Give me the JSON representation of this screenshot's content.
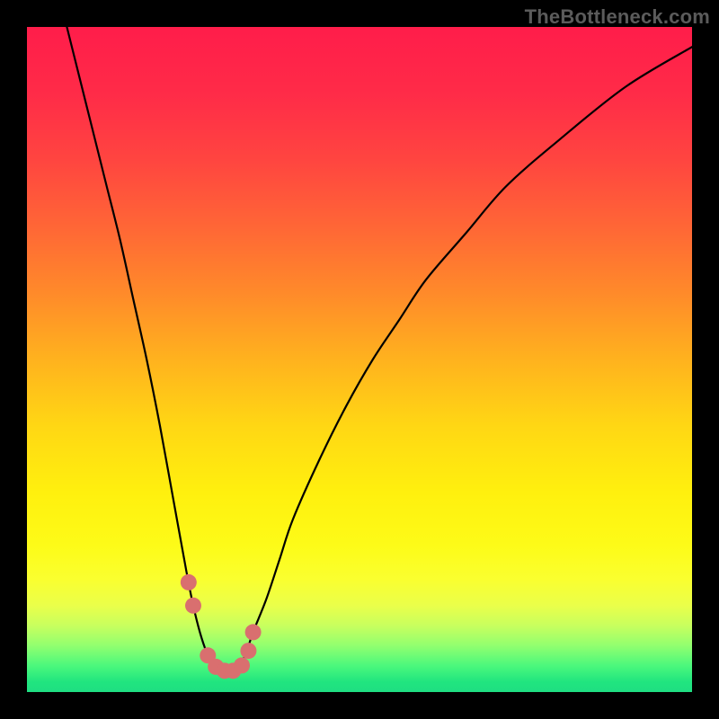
{
  "watermark": "TheBottleneck.com",
  "gradient_stops": [
    {
      "offset": 0.0,
      "color": "#ff1d4a"
    },
    {
      "offset": 0.1,
      "color": "#ff2b48"
    },
    {
      "offset": 0.2,
      "color": "#ff4540"
    },
    {
      "offset": 0.3,
      "color": "#ff6636"
    },
    {
      "offset": 0.4,
      "color": "#ff8a2a"
    },
    {
      "offset": 0.5,
      "color": "#ffb21e"
    },
    {
      "offset": 0.6,
      "color": "#ffd714"
    },
    {
      "offset": 0.7,
      "color": "#fff00e"
    },
    {
      "offset": 0.78,
      "color": "#fdfb18"
    },
    {
      "offset": 0.83,
      "color": "#faff2f"
    },
    {
      "offset": 0.87,
      "color": "#eaff4a"
    },
    {
      "offset": 0.9,
      "color": "#c8ff5e"
    },
    {
      "offset": 0.93,
      "color": "#92ff6f"
    },
    {
      "offset": 0.96,
      "color": "#4cf87c"
    },
    {
      "offset": 0.985,
      "color": "#20e57f"
    },
    {
      "offset": 1.0,
      "color": "#1fde82"
    }
  ],
  "marker_color": "#d96f6f",
  "marker_radius": 9,
  "curve_stroke": "#000000",
  "curve_width": 2.2,
  "chart_data": {
    "type": "line",
    "title": "",
    "xlabel": "",
    "ylabel": "",
    "xlim": [
      0,
      100
    ],
    "ylim": [
      0,
      100
    ],
    "series": [
      {
        "name": "bottleneck-curve",
        "x": [
          6,
          8,
          10,
          12,
          14,
          16,
          18,
          20,
          22,
          24,
          25,
          26,
          27,
          28,
          29,
          30,
          31,
          32,
          33,
          34,
          36,
          38,
          40,
          44,
          48,
          52,
          56,
          60,
          66,
          72,
          80,
          90,
          100
        ],
        "y": [
          100,
          92,
          84,
          76,
          68,
          59,
          50,
          40,
          29,
          18,
          13,
          9,
          6,
          4,
          3,
          3,
          3,
          4,
          6,
          9,
          14,
          20,
          26,
          35,
          43,
          50,
          56,
          62,
          69,
          76,
          83,
          91,
          97
        ]
      }
    ],
    "markers": {
      "name": "highlight-points",
      "x": [
        24.3,
        25.0,
        27.2,
        28.4,
        29.7,
        31.0,
        32.3,
        33.3,
        34.0
      ],
      "y": [
        16.5,
        13.0,
        5.5,
        3.8,
        3.2,
        3.2,
        4.0,
        6.2,
        9.0
      ]
    }
  }
}
